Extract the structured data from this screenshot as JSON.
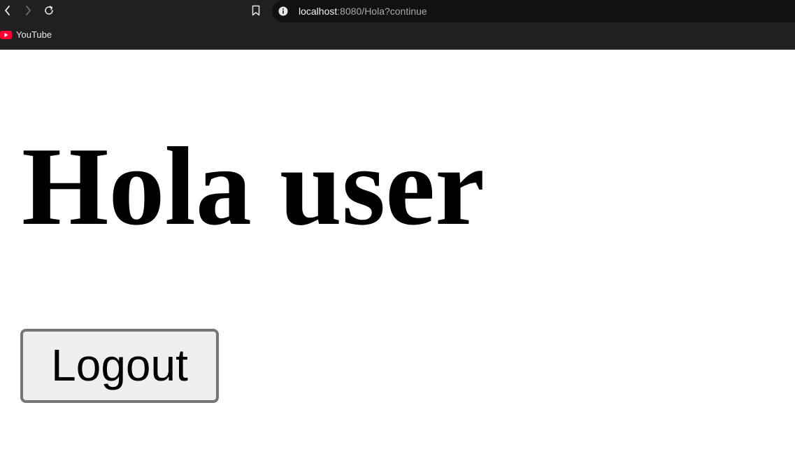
{
  "browser": {
    "url_host": "localhost",
    "url_rest": ":8080/Hola?continue",
    "icons": {
      "back": "chevron-left-icon",
      "forward": "chevron-right-icon",
      "reload": "reload-icon",
      "bookmark": "bookmark-icon",
      "site_info": "info-icon"
    },
    "bookmarks": [
      {
        "label": "YouTube",
        "icon": "youtube-icon",
        "color": "#ff0033"
      }
    ]
  },
  "page": {
    "title": "Hola user",
    "logout_label": "Logout"
  },
  "colors": {
    "chrome_bg": "#202023",
    "address_bg": "#111113",
    "page_bg": "#ffffff",
    "button_bg": "#efefef",
    "button_border": "#767676"
  }
}
